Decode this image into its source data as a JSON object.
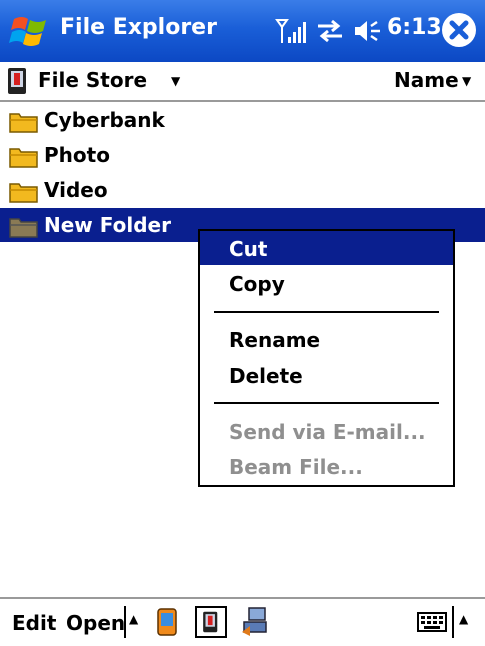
{
  "title_bar": {
    "app_title": "File Explorer",
    "time": "6:13",
    "icons": [
      "windows-start-icon",
      "signal-strength-icon",
      "connectivity-icon",
      "volume-icon",
      "close-icon"
    ]
  },
  "location_bar": {
    "location": "File Store",
    "sort_by": "Name"
  },
  "files": [
    {
      "name": "Cyberbank",
      "icon": "folder-icon",
      "selected": false
    },
    {
      "name": "Photo",
      "icon": "folder-icon",
      "selected": false
    },
    {
      "name": "Video",
      "icon": "folder-icon",
      "selected": false
    },
    {
      "name": "New Folder",
      "icon": "folder-icon",
      "selected": true
    }
  ],
  "context_menu": {
    "cut": "Cut",
    "copy": "Copy",
    "rename": "Rename",
    "delete": "Delete",
    "send_email": "Send via E-mail...",
    "beam_file": "Beam File..."
  },
  "menu_bar": {
    "edit": "Edit",
    "open": "Open"
  },
  "colors": {
    "title_bar": "#1a5fd8",
    "selection": "#0a1f8f",
    "disabled_text": "#8f8f8f",
    "folder": "#f2b91f"
  }
}
